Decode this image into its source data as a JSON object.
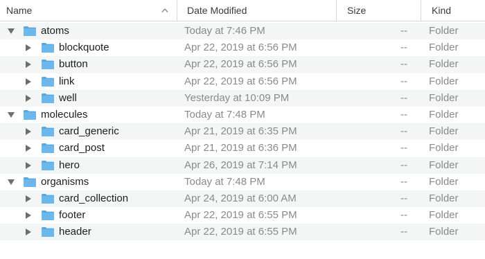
{
  "header": {
    "name": "Name",
    "date_modified": "Date Modified",
    "size": "Size",
    "kind": "Kind"
  },
  "rows": [
    {
      "name": "atoms",
      "date": "Today at 7:46 PM",
      "size": "--",
      "kind": "Folder",
      "level": 0,
      "expanded": true
    },
    {
      "name": "blockquote",
      "date": "Apr 22, 2019 at 6:56 PM",
      "size": "--",
      "kind": "Folder",
      "level": 1,
      "expanded": false
    },
    {
      "name": "button",
      "date": "Apr 22, 2019 at 6:56 PM",
      "size": "--",
      "kind": "Folder",
      "level": 1,
      "expanded": false
    },
    {
      "name": "link",
      "date": "Apr 22, 2019 at 6:56 PM",
      "size": "--",
      "kind": "Folder",
      "level": 1,
      "expanded": false
    },
    {
      "name": "well",
      "date": "Yesterday at 10:09 PM",
      "size": "--",
      "kind": "Folder",
      "level": 1,
      "expanded": false
    },
    {
      "name": "molecules",
      "date": "Today at 7:48 PM",
      "size": "--",
      "kind": "Folder",
      "level": 0,
      "expanded": true
    },
    {
      "name": "card_generic",
      "date": "Apr 21, 2019 at 6:35 PM",
      "size": "--",
      "kind": "Folder",
      "level": 1,
      "expanded": false
    },
    {
      "name": "card_post",
      "date": "Apr 21, 2019 at 6:36 PM",
      "size": "--",
      "kind": "Folder",
      "level": 1,
      "expanded": false
    },
    {
      "name": "hero",
      "date": "Apr 26, 2019 at 7:14 PM",
      "size": "--",
      "kind": "Folder",
      "level": 1,
      "expanded": false
    },
    {
      "name": "organisms",
      "date": "Today at 7:48 PM",
      "size": "--",
      "kind": "Folder",
      "level": 0,
      "expanded": true
    },
    {
      "name": "card_collection",
      "date": "Apr 24, 2019 at 6:00 AM",
      "size": "--",
      "kind": "Folder",
      "level": 1,
      "expanded": false
    },
    {
      "name": "footer",
      "date": "Apr 22, 2019 at 6:55 PM",
      "size": "--",
      "kind": "Folder",
      "level": 1,
      "expanded": false
    },
    {
      "name": "header",
      "date": "Apr 22, 2019 at 6:55 PM",
      "size": "--",
      "kind": "Folder",
      "level": 1,
      "expanded": false
    }
  ],
  "colors": {
    "folder_blue": "#6cb8ec",
    "folder_tab": "#5aa6dc",
    "row_alt": "#f4f5f5",
    "secondary_text": "#8a8a8a"
  },
  "icons": {
    "sort": "chevron-up-icon",
    "expanded": "disclosure-triangle-down-icon",
    "collapsed": "disclosure-triangle-right-icon",
    "folder": "folder-icon"
  }
}
